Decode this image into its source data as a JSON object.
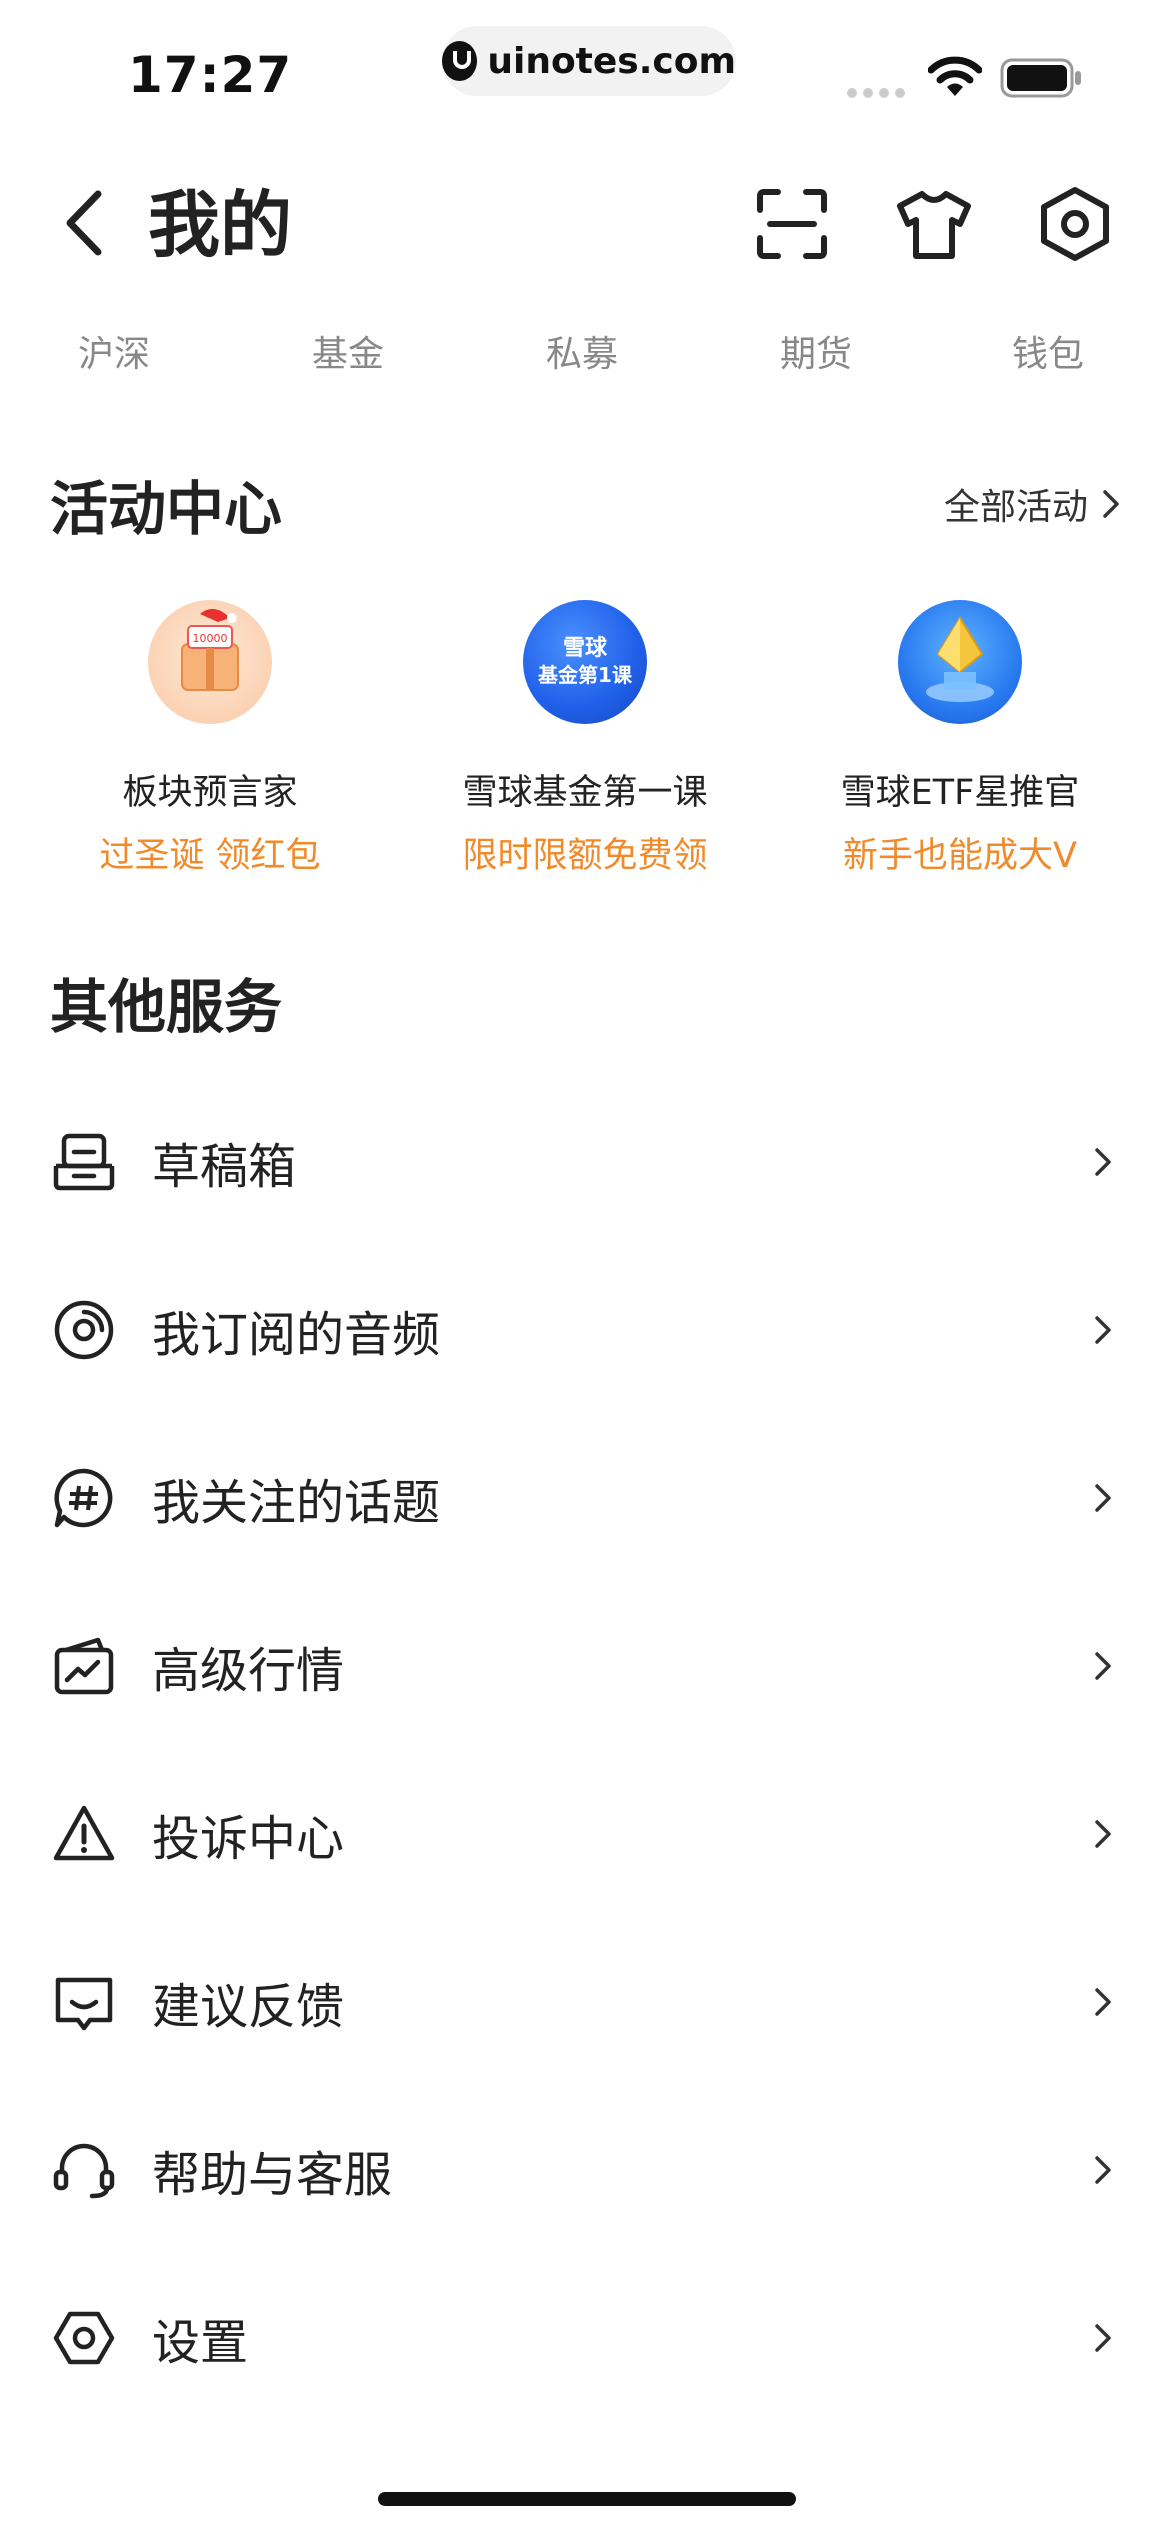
{
  "status_bar": {
    "time": "17:27",
    "url": "uinotes.com"
  },
  "header": {
    "title": "我的"
  },
  "tabs": [
    "沪深",
    "基金",
    "私募",
    "期货",
    "钱包"
  ],
  "activity": {
    "title": "活动中心",
    "all_label": "全部活动",
    "items": [
      {
        "name": "板块预言家",
        "sub": "过圣诞 领红包",
        "icon": "gift-box-icon"
      },
      {
        "name": "雪球基金第一课",
        "sub": "限时限额免费领",
        "icon": "course-badge-icon",
        "badge_line1": "雪球",
        "badge_line2": "基金第1课"
      },
      {
        "name": "雪球ETF星推官",
        "sub": "新手也能成大V",
        "icon": "crystal-trophy-icon"
      }
    ]
  },
  "services": {
    "title": "其他服务",
    "items": [
      {
        "label": "草稿箱",
        "icon": "draft-box-icon"
      },
      {
        "label": "我订阅的音频",
        "icon": "audio-disc-icon"
      },
      {
        "label": "我关注的话题",
        "icon": "topic-hash-icon"
      },
      {
        "label": "高级行情",
        "icon": "chart-trend-icon"
      },
      {
        "label": "投诉中心",
        "icon": "warning-icon"
      },
      {
        "label": "建议反馈",
        "icon": "feedback-icon"
      },
      {
        "label": "帮助与客服",
        "icon": "headset-icon"
      },
      {
        "label": "设置",
        "icon": "settings-hex-icon"
      }
    ]
  },
  "colors": {
    "accent": "#f08a2a",
    "text": "#222222",
    "muted": "#888888"
  }
}
